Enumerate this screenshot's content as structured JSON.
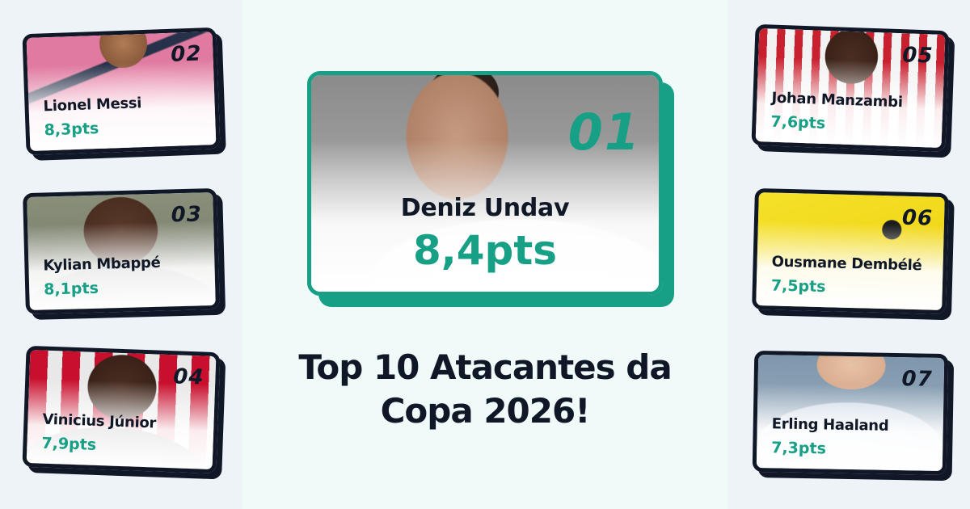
{
  "headline": {
    "line1": "Top 10 Atacantes da",
    "line2": "Copa 2026!"
  },
  "colors": {
    "accent": "#17a085",
    "dark": "#101828",
    "background": "#eef3f8",
    "center_background": "#effaf9"
  },
  "featured": {
    "rank": "01",
    "name": "Deniz Undav",
    "score": "8,4pts"
  },
  "left_cards": [
    {
      "rank": "02",
      "name": "Lionel Messi",
      "score": "8,3pts"
    },
    {
      "rank": "03",
      "name": "Kylian Mbappé",
      "score": "8,1pts"
    },
    {
      "rank": "04",
      "name": "Vinicius Júnior",
      "score": "7,9pts"
    }
  ],
  "right_cards": [
    {
      "rank": "05",
      "name": "Johan Manzambi",
      "score": "7,6pts"
    },
    {
      "rank": "06",
      "name": "Ousmane Dembélé",
      "score": "7,5pts"
    },
    {
      "rank": "07",
      "name": "Erling Haaland",
      "score": "7,3pts"
    }
  ]
}
